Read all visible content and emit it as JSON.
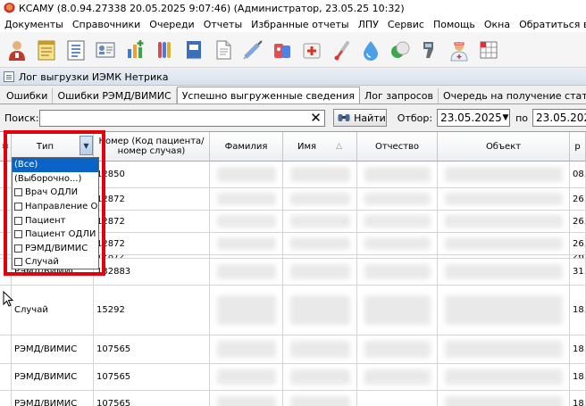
{
  "window": {
    "title": "КСАМУ (8.0.94.27338 20.05.2025 9:07:46) (Администратор, 23.05.25 10:32)"
  },
  "menu": [
    "Документы",
    "Справочники",
    "Очереди",
    "Отчеты",
    "Избранные отчеты",
    "ЛПУ",
    "Сервис",
    "Помощь",
    "Окна",
    "Обратиться в ООО \""
  ],
  "toolbar": [
    "doctor-icon",
    "notepad-icon",
    "list-icon",
    "id-card-icon",
    "chart-plus-icon",
    "lab-tubes-icon",
    "book-icon",
    "document-icon",
    "syringe-icon",
    "pills-icon",
    "first-aid-icon",
    "thermometer-icon",
    "water-drop-icon",
    "pills-round-icon",
    "scanner-icon",
    "nurse-icon",
    "grid-icon"
  ],
  "child_window": {
    "title": "Лог выгрузки ИЭМК Нетрика"
  },
  "tabs": [
    "Ошибки",
    "Ошибки РЭМД/ВИМИС",
    "Успешно выгруженные сведения",
    "Лог запросов",
    "Очередь на получение статусов документов"
  ],
  "active_tab": 2,
  "search": {
    "label": "Поиск:",
    "value": "",
    "clear": "✕",
    "find_label": "Найти",
    "filter_label": "Отбор:",
    "date_from": "23.05.2025",
    "to_label": "по",
    "date_to": "23.05.202"
  },
  "grid": {
    "columns": [
      {
        "key": "sel",
        "label": "≡"
      },
      {
        "key": "type",
        "label": "Тип"
      },
      {
        "key": "num",
        "label": "Номер (Код пациента/номер случая)"
      },
      {
        "key": "last",
        "label": "Фамилия"
      },
      {
        "key": "first",
        "label": "Имя"
      },
      {
        "key": "middle",
        "label": "Отчество"
      },
      {
        "key": "obj",
        "label": "Объект"
      },
      {
        "key": "extra",
        "label": "р"
      }
    ],
    "rows": [
      {
        "type": "",
        "num": "12850",
        "extra": "08."
      },
      {
        "type": "",
        "num": "12872",
        "extra": "26."
      },
      {
        "type": "",
        "num": "12872",
        "extra": "26."
      },
      {
        "type": "",
        "num": "12872",
        "extra": "26."
      },
      {
        "type": "",
        "num": "12872",
        "extra": "26."
      },
      {
        "type": "РЭМД/ВИМИС",
        "num": "132883",
        "extra": "31."
      },
      {
        "type": "Случай",
        "num": "15292",
        "extra": "18."
      },
      {
        "type": "РЭМД/ВИМИС",
        "num": "107565",
        "extra": "18."
      },
      {
        "type": "РЭМД/ВИМИС",
        "num": "107565",
        "extra": "18."
      },
      {
        "type": "РЭМД/ВИМИС",
        "num": "107565",
        "extra": "18."
      }
    ],
    "last_row_middle": "Анатольевна"
  },
  "filter_dropdown": {
    "items": [
      {
        "label": "(Все)",
        "checkbox": false,
        "selected": true
      },
      {
        "label": "(Выборочно...)",
        "checkbox": false,
        "selected": false
      },
      {
        "label": "Врач ОДЛИ",
        "checkbox": true,
        "selected": false
      },
      {
        "label": "Направление ОДЛИ",
        "checkbox": true,
        "selected": false
      },
      {
        "label": "Пациент",
        "checkbox": true,
        "selected": false
      },
      {
        "label": "Пациент ОДЛИ",
        "checkbox": true,
        "selected": false
      },
      {
        "label": "РЭМД/ВИМИС",
        "checkbox": true,
        "selected": false
      },
      {
        "label": "Случай",
        "checkbox": true,
        "selected": false
      }
    ]
  },
  "colors": {
    "highlight_frame": "#e3000b",
    "selection": "#0a64c8"
  }
}
